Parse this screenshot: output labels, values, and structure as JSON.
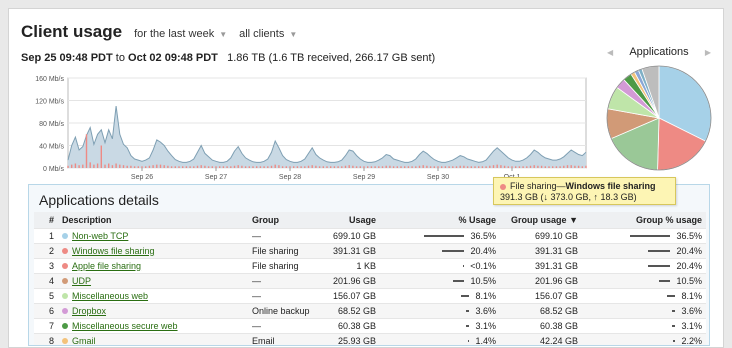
{
  "header": {
    "title": "Client usage",
    "period": "for the last week",
    "clients": "all clients"
  },
  "range": {
    "start": "Sep 25 09:48 PDT",
    "to": "to",
    "end": "Oct 02 09:48 PDT",
    "summary": "1.86 TB (1.6 TB received, 266.17 GB sent)"
  },
  "pie_nav": {
    "label": "Applications"
  },
  "colors": {
    "accent_link": "#2a6e12",
    "area_fill": "#c9d9e4",
    "area_line": "#7e9fb3",
    "received_bar": "#ee8a84"
  },
  "chart_data": [
    {
      "type": "area",
      "title": "",
      "ylabel": "",
      "y_unit": "Mb/s",
      "ylim": [
        0,
        160
      ],
      "y_ticks": [
        "0 Mb/s",
        "40 Mb/s",
        "80 Mb/s",
        "120 Mb/s",
        "160 Mb/s"
      ],
      "x_tick_labels": [
        "Sep 26",
        "Sep 27",
        "Sep 28",
        "Sep 29",
        "Sep 30",
        "Oct 1"
      ],
      "grid": true,
      "x": [
        0,
        0.05,
        0.1,
        0.15,
        0.2,
        0.25,
        0.3,
        0.35,
        0.4,
        0.45,
        0.5,
        0.55,
        0.6,
        0.65,
        0.7,
        0.75,
        0.8,
        0.85,
        0.9,
        0.95,
        1.0,
        1.05,
        1.1,
        1.15,
        1.2,
        1.25,
        1.3,
        1.35,
        1.4,
        1.45,
        1.5,
        1.55,
        1.6,
        1.65,
        1.7,
        1.75,
        1.8,
        1.85,
        1.9,
        1.95,
        2.0,
        2.05,
        2.1,
        2.15,
        2.2,
        2.25,
        2.3,
        2.35,
        2.4,
        2.45,
        2.5,
        2.55,
        2.6,
        2.65,
        2.7,
        2.75,
        2.8,
        2.85,
        2.9,
        2.95,
        3.0,
        3.05,
        3.1,
        3.15,
        3.2,
        3.25,
        3.3,
        3.35,
        3.4,
        3.45,
        3.5,
        3.55,
        3.6,
        3.65,
        3.7,
        3.75,
        3.8,
        3.85,
        3.9,
        3.95,
        4.0,
        4.05,
        4.1,
        4.15,
        4.2,
        4.25,
        4.3,
        4.35,
        4.4,
        4.45,
        4.5,
        4.55,
        4.6,
        4.65,
        4.7,
        4.75,
        4.8,
        4.85,
        4.9,
        4.95,
        5.0,
        5.05,
        5.1,
        5.15,
        5.2,
        5.25,
        5.3,
        5.35,
        5.4,
        5.45,
        5.5,
        5.55,
        5.6,
        5.65,
        5.7,
        5.75,
        5.8,
        5.85,
        5.9,
        5.95,
        6.0,
        6.05,
        6.1,
        6.15,
        6.2,
        6.25,
        6.3,
        6.35,
        6.4,
        6.45,
        6.5,
        6.55,
        6.6,
        6.65,
        6.7,
        6.75,
        6.8,
        6.85,
        6.9,
        6.95,
        7.0
      ],
      "series": [
        {
          "values": [
            14,
            40,
            55,
            32,
            38,
            58,
            72,
            42,
            60,
            68,
            45,
            68,
            52,
            110,
            60,
            42,
            36,
            22,
            16,
            14,
            12,
            14,
            18,
            32,
            50,
            46,
            40,
            30,
            22,
            15,
            12,
            10,
            10,
            12,
            16,
            28,
            40,
            26,
            20,
            14,
            12,
            10,
            10,
            12,
            18,
            30,
            38,
            26,
            18,
            14,
            11,
            10,
            10,
            12,
            16,
            28,
            48,
            36,
            22,
            15,
            12,
            10,
            10,
            12,
            16,
            26,
            36,
            24,
            18,
            14,
            11,
            10,
            10,
            11,
            14,
            22,
            32,
            30,
            22,
            16,
            12,
            10,
            10,
            11,
            14,
            18,
            24,
            22,
            16,
            14,
            12,
            10,
            10,
            12,
            16,
            24,
            30,
            26,
            20,
            15,
            12,
            10,
            10,
            12,
            14,
            18,
            22,
            20,
            16,
            14,
            12,
            10,
            11,
            14,
            22,
            30,
            36,
            30,
            24,
            18,
            14,
            12,
            12,
            14,
            18,
            24,
            32,
            28,
            22,
            18,
            16,
            14,
            14,
            16,
            20,
            26,
            32,
            28,
            24,
            22,
            28
          ]
        },
        {
          "values": [
            4,
            6,
            8,
            5,
            6,
            60,
            10,
            6,
            8,
            40,
            6,
            8,
            5,
            8,
            6,
            5,
            4,
            4,
            3,
            3,
            3,
            3,
            4,
            5,
            6,
            6,
            5,
            4,
            3,
            3,
            3,
            3,
            3,
            3,
            3,
            4,
            5,
            4,
            3,
            3,
            3,
            3,
            3,
            3,
            3,
            4,
            5,
            4,
            3,
            3,
            3,
            3,
            3,
            3,
            3,
            4,
            6,
            5,
            3,
            3,
            3,
            3,
            3,
            3,
            3,
            4,
            5,
            4,
            3,
            3,
            3,
            3,
            3,
            3,
            3,
            4,
            5,
            4,
            3,
            3,
            3,
            3,
            3,
            3,
            3,
            3,
            4,
            4,
            3,
            3,
            3,
            3,
            3,
            3,
            3,
            4,
            5,
            4,
            3,
            3,
            3,
            3,
            3,
            3,
            3,
            3,
            4,
            4,
            3,
            3,
            3,
            3,
            3,
            3,
            4,
            5,
            6,
            5,
            4,
            3,
            3,
            3,
            3,
            3,
            3,
            4,
            5,
            4,
            4,
            3,
            3,
            3,
            3,
            3,
            4,
            5,
            5,
            4,
            4,
            3,
            4
          ]
        }
      ]
    },
    {
      "type": "pie",
      "title": "",
      "slices": [
        {
          "value": 36.5,
          "color": "#a6d1e8"
        },
        {
          "value": 20.4,
          "color": "#ee8a84"
        },
        {
          "value": 20.4,
          "color": "#9ac897"
        },
        {
          "value": 10.5,
          "color": "#d19a77"
        },
        {
          "value": 8.1,
          "color": "#bfe5a9"
        },
        {
          "value": 3.6,
          "color": "#d39ad6"
        },
        {
          "value": 3.1,
          "color": "#4d9a46"
        },
        {
          "value": 1.4,
          "color": "#f3c27a"
        },
        {
          "value": 1.5,
          "color": "#8aa7d6"
        },
        {
          "value": 1.3,
          "color": "#7fb0c6"
        },
        {
          "value": 6.0,
          "color": "#bdbdbd"
        }
      ]
    }
  ],
  "tooltip": {
    "app": "File sharing",
    "dash": "—",
    "detail": "Windows file sharing",
    "size": "391.3 GB (↓ 373.0 GB, ↑ 18.3 GB)",
    "color": "#ee8a84"
  },
  "details": {
    "title": "Applications details",
    "columns": {
      "num": "#",
      "description": "Description",
      "group": "Group",
      "usage": "Usage",
      "pct_usage": "% Usage",
      "group_usage": "Group usage",
      "sort_arrow": "▼",
      "group_pct": "Group % usage"
    },
    "rows": [
      {
        "num": "1",
        "color": "#a6d1e8",
        "description": "Non-web TCP",
        "group": "—",
        "usage": "699.10 GB",
        "pct_label": "36.5%",
        "pct": 36.5,
        "group_usage": "699.10 GB",
        "group_pct_label": "36.5%",
        "group_pct": 36.5
      },
      {
        "num": "2",
        "color": "#ee8a84",
        "description": "Windows file sharing",
        "group": "File sharing",
        "usage": "391.31 GB",
        "pct_label": "20.4%",
        "pct": 20.4,
        "group_usage": "391.31 GB",
        "group_pct_label": "20.4%",
        "group_pct": 20.4
      },
      {
        "num": "3",
        "color": "#ee8a84",
        "description": "Apple file sharing",
        "group": "File sharing",
        "usage": "1 KB",
        "pct_label": "<0.1%",
        "pct": 0.05,
        "group_usage": "391.31 GB",
        "group_pct_label": "20.4%",
        "group_pct": 20.4
      },
      {
        "num": "4",
        "color": "#d19a77",
        "description": "UDP",
        "group": "—",
        "usage": "201.96 GB",
        "pct_label": "10.5%",
        "pct": 10.5,
        "group_usage": "201.96 GB",
        "group_pct_label": "10.5%",
        "group_pct": 10.5
      },
      {
        "num": "5",
        "color": "#bfe5a9",
        "description": "Miscellaneous web",
        "group": "—",
        "usage": "156.07 GB",
        "pct_label": "8.1%",
        "pct": 8.1,
        "group_usage": "156.07 GB",
        "group_pct_label": "8.1%",
        "group_pct": 8.1
      },
      {
        "num": "6",
        "color": "#d39ad6",
        "description": "Dropbox",
        "group": "Online backup",
        "usage": "68.52 GB",
        "pct_label": "3.6%",
        "pct": 3.6,
        "group_usage": "68.52 GB",
        "group_pct_label": "3.6%",
        "group_pct": 3.6
      },
      {
        "num": "7",
        "color": "#4d9a46",
        "description": "Miscellaneous secure web",
        "group": "—",
        "usage": "60.38 GB",
        "pct_label": "3.1%",
        "pct": 3.1,
        "group_usage": "60.38 GB",
        "group_pct_label": "3.1%",
        "group_pct": 3.1
      },
      {
        "num": "8",
        "color": "#f3c27a",
        "description": "Gmail",
        "group": "Email",
        "usage": "25.93 GB",
        "pct_label": "1.4%",
        "pct": 1.4,
        "group_usage": "42.24 GB",
        "group_pct_label": "2.2%",
        "group_pct": 2.2
      }
    ]
  }
}
